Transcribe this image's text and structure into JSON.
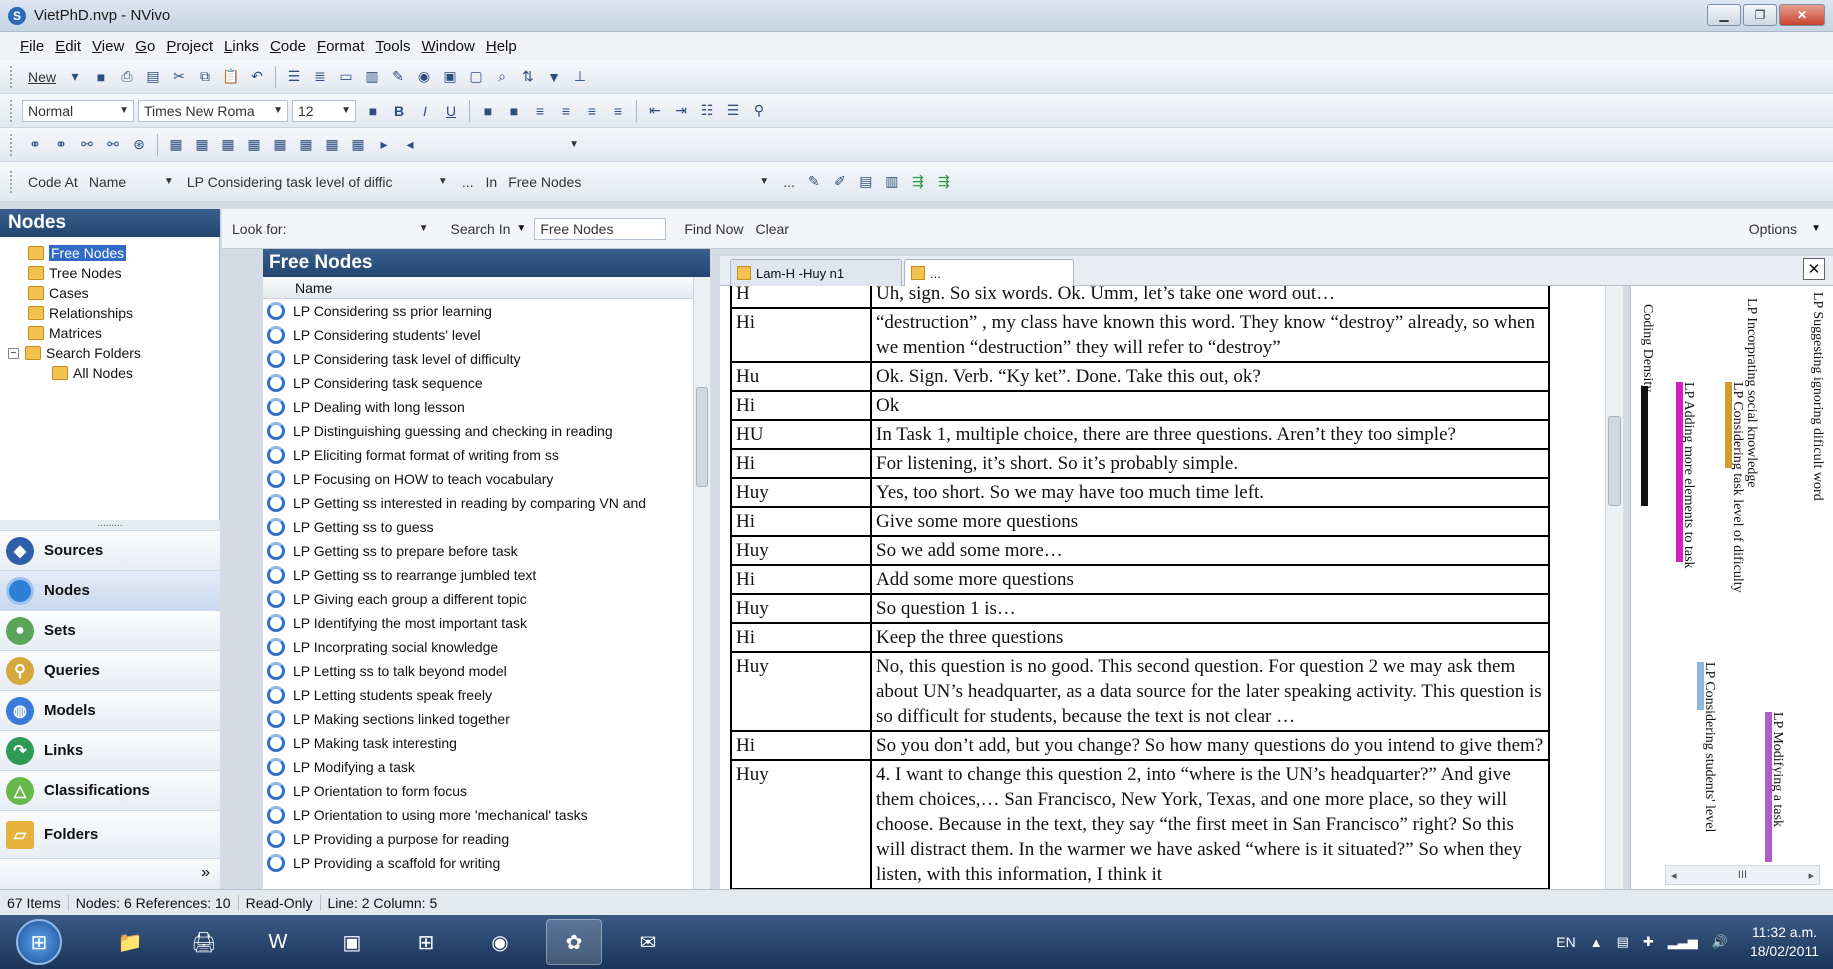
{
  "window": {
    "title": "VietPhD.nvp - NVivo",
    "app_icon": "nvivo-icon"
  },
  "menu": [
    "File",
    "Edit",
    "View",
    "Go",
    "Project",
    "Links",
    "Code",
    "Format",
    "Tools",
    "Window",
    "Help"
  ],
  "toolbar1": {
    "new_label": "New"
  },
  "toolbar2": {
    "style_value": "Normal",
    "font_value": "Times New Roma",
    "size_value": "12"
  },
  "codebar": {
    "code_at_label": "Code At",
    "name_label": "Name",
    "name_value": "LP Considering task level of diffic",
    "dots": "...",
    "in_label": "In",
    "in_value": "Free Nodes"
  },
  "left": {
    "header": "Nodes",
    "tree": [
      {
        "label": "Free Nodes",
        "selected": true
      },
      {
        "label": "Tree Nodes"
      },
      {
        "label": "Cases"
      },
      {
        "label": "Relationships"
      },
      {
        "label": "Matrices"
      },
      {
        "label": "Search Folders"
      },
      {
        "label": "All Nodes"
      }
    ],
    "splitter": ".........",
    "nav": [
      "Sources",
      "Nodes",
      "Sets",
      "Queries",
      "Models",
      "Links",
      "Classifications",
      "Folders"
    ],
    "more": "»"
  },
  "findbar": {
    "look_for_label": "Look for:",
    "search_in_label": "Search In",
    "search_in_value": "Free Nodes",
    "find_now": "Find Now",
    "clear": "Clear",
    "options": "Options"
  },
  "list": {
    "header": "Free Nodes",
    "column": "Name",
    "items": [
      "LP Considering ss prior learning",
      "LP Considering students' level",
      "LP Considering task level of difficulty",
      "LP Considering task sequence",
      "LP Dealing with long lesson",
      "LP Distinguishing guessing and checking in reading",
      "LP Eliciting format format of writing from ss",
      "LP Focusing on HOW to teach vocabulary",
      "LP Getting ss interested in reading by comparing VN and",
      "LP Getting ss to guess",
      "LP Getting ss to prepare before task",
      "LP Getting ss to rearrange jumbled text",
      "LP Giving each group a different topic",
      "LP Identifying the most important task",
      "LP Incorprating social knowledge",
      "LP Letting ss to talk beyond model",
      "LP Letting students speak freely",
      "LP Making sections linked together",
      "LP Making task interesting",
      "LP Modifying a task",
      "LP Orientation to form focus",
      "LP Orientation to using more 'mechanical' tasks",
      "LP Providing a purpose for reading",
      "LP Providing a scaffold for writing"
    ]
  },
  "doc": {
    "tabs": [
      "Lam-H -Huy n1",
      "..."
    ],
    "rows": [
      {
        "sp": "H",
        "text": "Uh, sign. So six words. Ok. Umm, let’s take one word out…"
      },
      {
        "sp": "Hi",
        "text": "“destruction” , my class have known this word. They know “destroy” already, so when we mention “destruction” they will refer to “destroy”"
      },
      {
        "sp": "Hu",
        "text": "Ok. Sign. Verb. “Ky ket”. Done. Take this out, ok?"
      },
      {
        "sp": "Hi",
        "text": "Ok"
      },
      {
        "sp": "HU",
        "text": "In Task 1, multiple choice, there are three questions. Aren’t they too simple?"
      },
      {
        "sp": "Hi",
        "text": "For listening, it’s short. So it’s probably simple."
      },
      {
        "sp": "Huy",
        "text": "Yes, too short. So we may have too much time left."
      },
      {
        "sp": "Hi",
        "text": "Give some more questions"
      },
      {
        "sp": "Huy",
        "text": "So we add some more…"
      },
      {
        "sp": "Hi",
        "text": "Add some more questions"
      },
      {
        "sp": "Huy",
        "text": "So question 1 is…"
      },
      {
        "sp": "Hi",
        "text": "Keep the three questions"
      },
      {
        "sp": "Huy",
        "text": "No, this question is no good. This second question. For question 2 we may ask them about UN’s headquarter, as a data source for the later speaking activity. This question is so difficult for students, because the text is not clear …"
      },
      {
        "sp": "Hi",
        "text": "So you don’t add, but you change? So how many questions do you intend to give them?"
      },
      {
        "sp": "Huy",
        "text": "4. I want to change this question 2, into “where is the UN’s headquarter?” And give them choices,… San Francisco, New York, Texas, and one more place, so they will choose. Because in the text, they say “the first meet in San Francisco” right? So this will distract them. In the warmer we have asked “where is it situated?” So when they listen, with this information, I think it"
      }
    ]
  },
  "stripes": {
    "labels": [
      "Coding Density",
      "LP Incorprating social knowledge",
      "LP Suggesting ignoring dificult word",
      "LP Adding more elements to task",
      "LP Considering task level of dificulty",
      "LP Considering students' level",
      "LP Modifying a task"
    ],
    "colors": {
      "magenta": "#d61fbf",
      "orange": "#d99a2c",
      "lightblue": "#8fb9dc",
      "purple": "#b05cc6",
      "density": "#111111"
    }
  },
  "status": [
    "67 Items",
    "Nodes: 6  References: 10",
    "Read-Only",
    "Line: 2  Column: 5"
  ],
  "taskbar": {
    "lang": "EN",
    "time": "11:32 a.m.",
    "date": "18/02/2011"
  }
}
